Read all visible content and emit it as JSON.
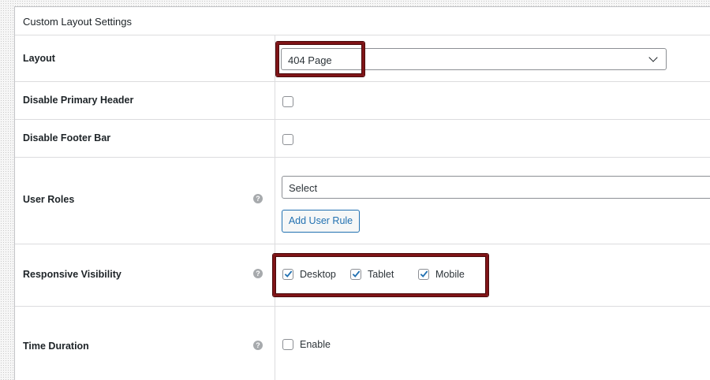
{
  "panel": {
    "title": "Custom Layout Settings"
  },
  "rows": {
    "layout": {
      "label": "Layout",
      "selected": "404 Page"
    },
    "disable_primary_header": {
      "label": "Disable Primary Header",
      "checked": false
    },
    "disable_footer_bar": {
      "label": "Disable Footer Bar",
      "checked": false
    },
    "user_roles": {
      "label": "User Roles",
      "select_value": "Select",
      "add_button": "Add User Rule"
    },
    "responsive_visibility": {
      "label": "Responsive Visibility",
      "options": [
        {
          "label": "Desktop",
          "checked": true
        },
        {
          "label": "Tablet",
          "checked": true
        },
        {
          "label": "Mobile",
          "checked": true
        }
      ]
    },
    "time_duration": {
      "label": "Time Duration",
      "enable_label": "Enable",
      "checked": false
    }
  },
  "help_icon_text": "?",
  "colors": {
    "highlight": "#7f1417",
    "primary": "#2271b1",
    "checkmark": "#2271b1",
    "border": "#dcdcde"
  }
}
